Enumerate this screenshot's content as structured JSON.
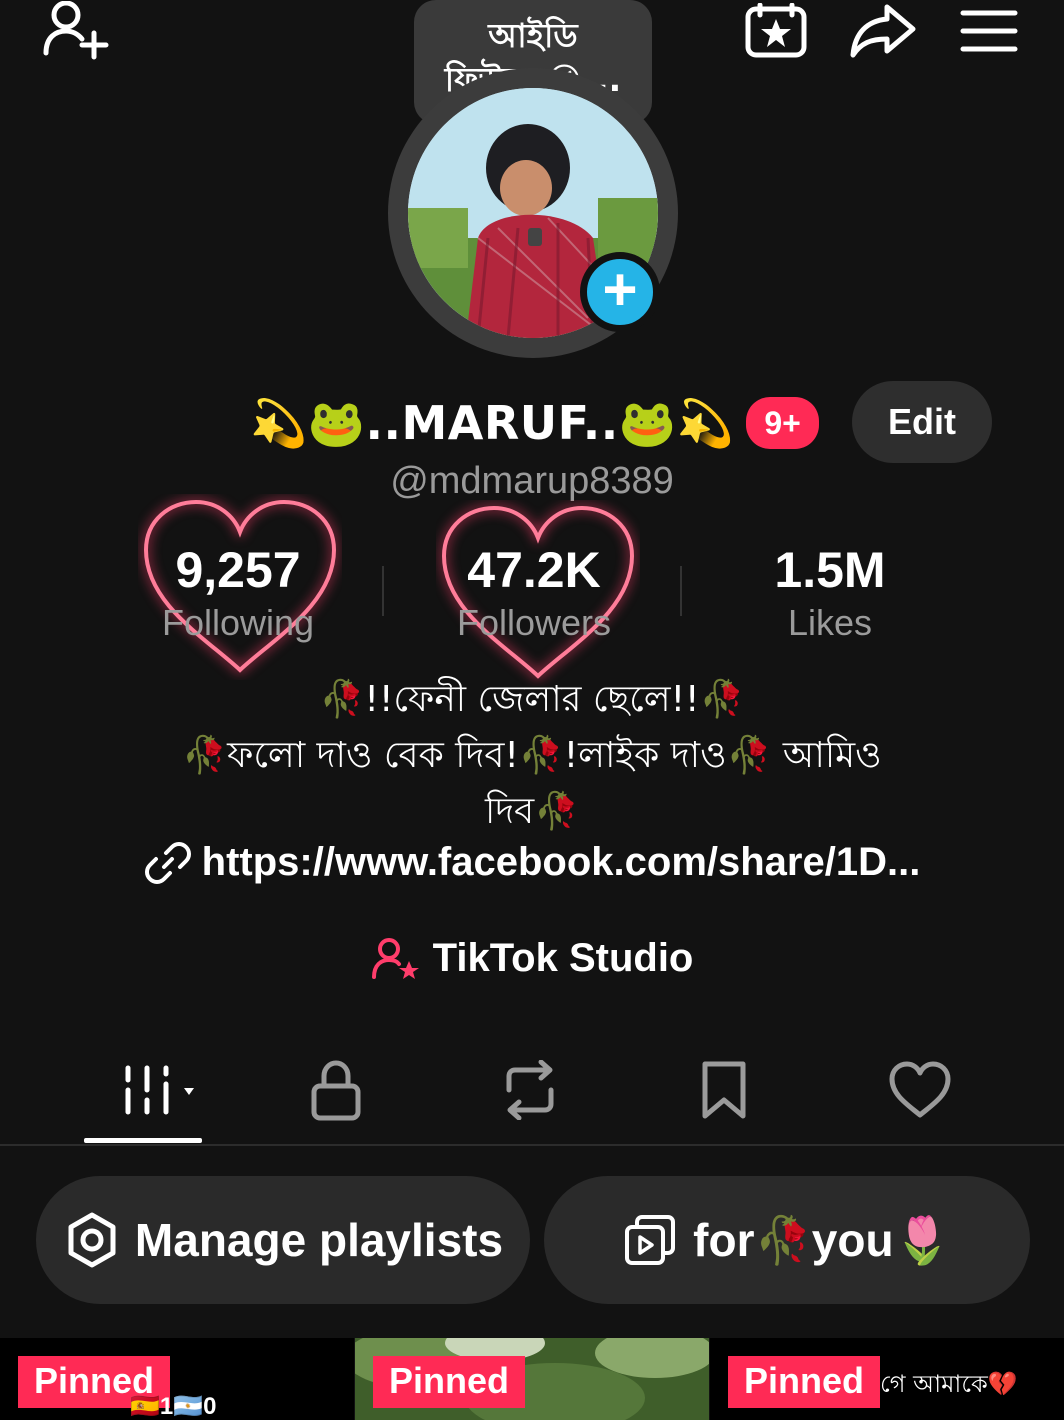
{
  "topbar": {
    "note_text_line1": "আইডি",
    "note_text_line2": "ফিউজ 😭..."
  },
  "profile": {
    "display_name": "💫🐸..MARUF..🐸💫",
    "badge": "9+",
    "edit_label": "Edit",
    "username": "@mdmarup8389"
  },
  "stats": [
    {
      "value": "9,257",
      "label": "Following"
    },
    {
      "value": "47.2K",
      "label": "Followers"
    },
    {
      "value": "1.5M",
      "label": "Likes"
    }
  ],
  "bio": {
    "line1": "🥀!!ফেনী জেলার ছেলে!!🥀",
    "line2": "🥀ফলো দাও বেক দিব!🥀!লাইক দাও🥀 আমিও",
    "line3": "দিব🥀",
    "link": "https://www.facebook.com/share/1D..."
  },
  "studio": {
    "label": "TikTok Studio"
  },
  "playlists": [
    {
      "label": "Manage playlists"
    },
    {
      "label": "for🥀you🌷"
    }
  ],
  "videos": [
    {
      "pinned_label": "Pinned",
      "overlay_text": "🇪🇸1🇦🇷0"
    },
    {
      "pinned_label": "Pinned",
      "overlay_text": ""
    },
    {
      "pinned_label": "Pinned",
      "overlay_text": "গে আমাকে💔"
    }
  ],
  "colors": {
    "background": "#121212",
    "accent": "#ff2a55",
    "avatar_plus": "#25b4e7",
    "heart_glow": "#ff6f8f"
  }
}
